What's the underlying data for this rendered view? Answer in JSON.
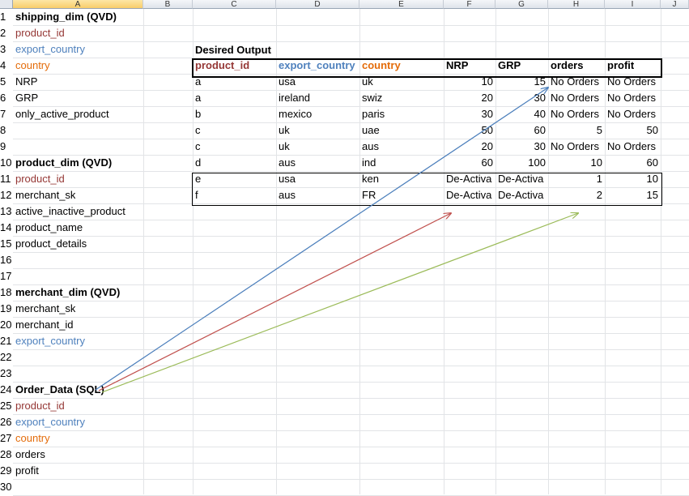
{
  "colors": {
    "red": "#953735",
    "blue": "#4f81bd",
    "orange": "#e46c0a",
    "green": "#9bbb59",
    "arrow_blue": "#4a7ebb",
    "arrow_red": "#c0504d",
    "arrow_green": "#9bbb59"
  },
  "columns": [
    "A",
    "B",
    "C",
    "D",
    "E",
    "F",
    "G",
    "H",
    "I",
    "J"
  ],
  "rows": [
    "1",
    "2",
    "3",
    "4",
    "5",
    "6",
    "7",
    "8",
    "9",
    "10",
    "11",
    "12",
    "13",
    "14",
    "15",
    "16",
    "17",
    "18",
    "19",
    "20",
    "21",
    "22",
    "23",
    "24",
    "25",
    "26",
    "27",
    "28",
    "29",
    "30"
  ],
  "col_a": [
    {
      "text": "shipping_dim (QVD)",
      "style": "bold"
    },
    {
      "text": "product_id",
      "style": "red"
    },
    {
      "text": "export_country",
      "style": "blue"
    },
    {
      "text": "country",
      "style": "orange"
    },
    {
      "text": "NRP",
      "style": ""
    },
    {
      "text": "GRP",
      "style": ""
    },
    {
      "text": "only_active_product",
      "style": ""
    },
    {
      "text": "",
      "style": ""
    },
    {
      "text": "",
      "style": ""
    },
    {
      "text": "product_dim (QVD)",
      "style": "bold"
    },
    {
      "text": "product_id",
      "style": "red"
    },
    {
      "text": "merchant_sk",
      "style": ""
    },
    {
      "text": "active_inactive_product",
      "style": ""
    },
    {
      "text": "product_name",
      "style": ""
    },
    {
      "text": "product_details",
      "style": ""
    },
    {
      "text": "",
      "style": ""
    },
    {
      "text": "",
      "style": ""
    },
    {
      "text": "merchant_dim (QVD)",
      "style": "bold"
    },
    {
      "text": "merchant_sk",
      "style": ""
    },
    {
      "text": "merchant_id",
      "style": ""
    },
    {
      "text": "export_country",
      "style": "blue"
    },
    {
      "text": "",
      "style": ""
    },
    {
      "text": "",
      "style": ""
    },
    {
      "text": "Order_Data (SQL)",
      "style": "bold"
    },
    {
      "text": "product_id",
      "style": "red"
    },
    {
      "text": "export_country",
      "style": "blue"
    },
    {
      "text": "country",
      "style": "orange"
    },
    {
      "text": "orders",
      "style": ""
    },
    {
      "text": "profit",
      "style": ""
    },
    {
      "text": "",
      "style": ""
    }
  ],
  "output": {
    "title": "Desired Output",
    "headers": [
      "product_id",
      "export_country",
      "country",
      "NRP",
      "GRP",
      "orders",
      "profit"
    ],
    "rows": [
      [
        "a",
        "usa",
        "uk",
        "10",
        "15",
        "No Orders",
        "No Orders"
      ],
      [
        "a",
        "ireland",
        "swiz",
        "20",
        "30",
        "No Orders",
        "No Orders"
      ],
      [
        "b",
        "mexico",
        "paris",
        "30",
        "40",
        "No Orders",
        "No Orders"
      ],
      [
        "c",
        "uk",
        "uae",
        "50",
        "60",
        "5",
        "50"
      ],
      [
        "c",
        "uk",
        "aus",
        "20",
        "30",
        "No Orders",
        "No Orders"
      ],
      [
        "d",
        "aus",
        "ind",
        "60",
        "100",
        "10",
        "60"
      ],
      [
        "e",
        "usa",
        "ken",
        "De-Activa",
        "De-Activa",
        "1",
        "10"
      ],
      [
        "f",
        "aus",
        "FR",
        "De-Activa",
        "De-Activa",
        "2",
        "15"
      ]
    ]
  }
}
